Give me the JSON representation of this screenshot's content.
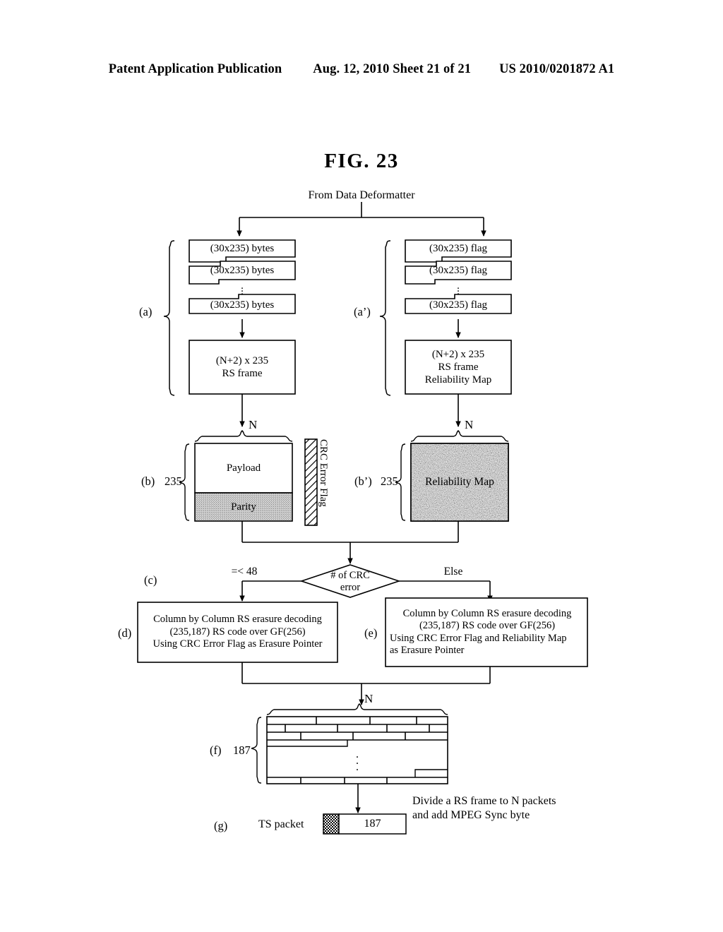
{
  "header": {
    "publication": "Patent Application Publication",
    "date_sheet": "Aug. 12, 2010  Sheet 21 of 21",
    "patent_number": "US 2010/0201872 A1"
  },
  "figure": {
    "title": "FIG. 23",
    "source_label": "From Data Deformatter"
  },
  "sections": {
    "a": {
      "id": "(a)",
      "stack_boxes": [
        "(30x235) bytes",
        "(30x235) bytes",
        "(30x235) bytes"
      ],
      "frame_box": [
        "(N+2) x 235",
        "RS frame"
      ]
    },
    "a_prime": {
      "id": "(a’)",
      "stack_boxes": [
        "(30x235) flag",
        "(30x235) flag",
        "(30x235) flag"
      ],
      "frame_box": [
        "(N+2) x 235",
        "RS frame",
        "Reliability Map"
      ]
    },
    "b": {
      "id": "(b)",
      "height_label": "235",
      "width_label": "N",
      "payload_label": "Payload",
      "parity_label": "Parity",
      "crc_strip_label": "CRC Error Flag"
    },
    "b_prime": {
      "id": "(b’)",
      "height_label": "235",
      "width_label": "N",
      "map_label": "Reliability Map"
    },
    "c": {
      "id": "(c)",
      "decision": [
        "# of CRC",
        "error"
      ],
      "branch_left": "=< 48",
      "branch_right": "Else"
    },
    "d": {
      "id": "(d)",
      "lines": [
        "Column by Column RS erasure decoding",
        "(235,187) RS code over GF(256)",
        "Using CRC Error Flag as Erasure Pointer"
      ]
    },
    "e": {
      "id": "(e)",
      "lines": [
        "Column by Column RS erasure decoding",
        "(235,187) RS code over GF(256)",
        "Using CRC Error Flag and Reliability Map",
        "as Erasure Pointer"
      ]
    },
    "f": {
      "id": "(f)",
      "height_label": "187",
      "width_label": "N"
    },
    "g": {
      "id": "(g)",
      "ts_packet_label": "TS packet",
      "payload_size_label": "187",
      "note_lines": [
        "Divide a RS frame to N packets",
        "and add MPEG Sync byte"
      ]
    }
  },
  "colors": {
    "ink": "#000000",
    "paper": "#ffffff",
    "parity_fill": "#c9c9c9",
    "reliability_fill": "#e2e2e2"
  }
}
